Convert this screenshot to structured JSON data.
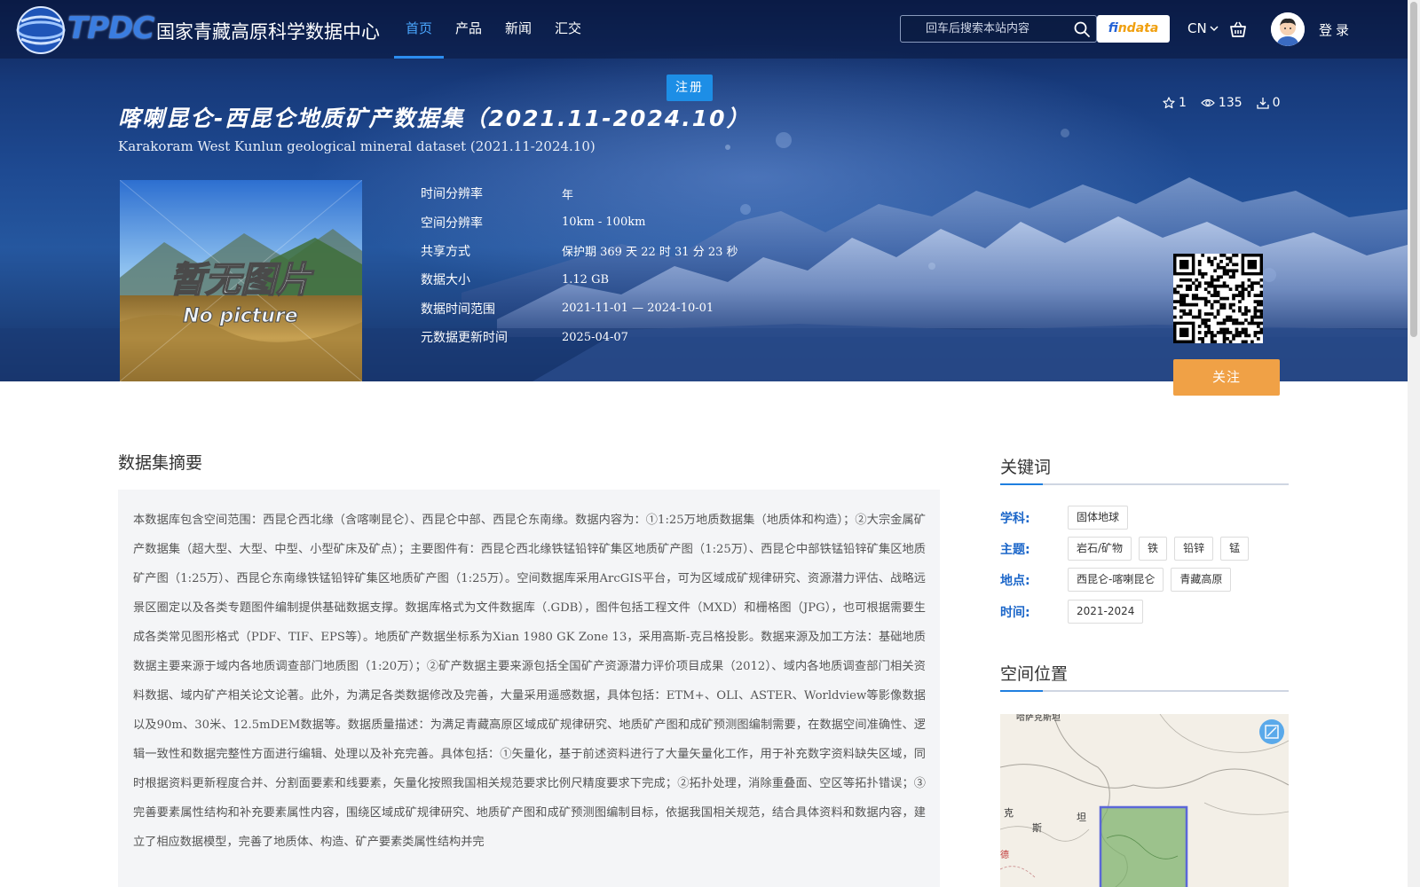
{
  "nav": {
    "logo_abbr": "TPDC",
    "logo_name": "国家青藏高原科学数据中心",
    "menu": [
      {
        "label": "首页",
        "active": true
      },
      {
        "label": "产品",
        "active": false
      },
      {
        "label": "新闻",
        "active": false
      },
      {
        "label": "汇交",
        "active": false
      }
    ],
    "search_placeholder": "回车后搜索本站内容",
    "findata": {
      "f": "f",
      "i": "i",
      "rest": "ndata"
    },
    "lang": "CN",
    "login": "登录",
    "register": "注册"
  },
  "dataset": {
    "title_cn": "喀喇昆仑-西昆仑地质矿产数据集（2021.11-2024.10）",
    "title_en": "Karakoram West Kunlun geological mineral dataset (2021.11-2024.10)",
    "stats": {
      "stars": "1",
      "views": "135",
      "downloads": "0"
    },
    "thumbnail": {
      "cn": "暂无图片",
      "en": "No picture"
    },
    "info": [
      {
        "label": "时间分辨率",
        "value": "年"
      },
      {
        "label": "空间分辨率",
        "value": "10km - 100km"
      },
      {
        "label": "共享方式",
        "value": "保护期 369 天 22 时 31 分 23 秒"
      },
      {
        "label": "数据大小",
        "value": "1.12 GB"
      },
      {
        "label": "数据时间范围",
        "value": "2021-11-01 — 2024-10-01"
      },
      {
        "label": "元数据更新时间",
        "value": "2025-04-07"
      }
    ],
    "follow": "关注"
  },
  "abstract": {
    "title": "数据集摘要",
    "text": "本数据库包含空间范围：西昆仑西北缘（含喀喇昆仑）、西昆仑中部、西昆仑东南缘。数据内容为：①1:25万地质数据集（地质体和构造）；②大宗金属矿产数据集（超大型、大型、中型、小型矿床及矿点）；主要图件有：西昆仑西北缘铁锰铅锌矿集区地质矿产图（1:25万）、西昆仑中部铁锰铅锌矿集区地质矿产图（1:25万）、西昆仑东南缘铁锰铅锌矿集区地质矿产图（1:25万）。空间数据库采用ArcGIS平台，可为区域成矿规律研究、资源潜力评估、战略远景区圈定以及各类专题图件编制提供基础数据支撑。数据库格式为文件数据库（.GDB），图件包括工程文件（MXD）和栅格图（JPG），也可根据需要生成各类常见图形格式（PDF、TIF、EPS等）。地质矿产数据坐标系为Xian 1980 GK Zone 13，采用高斯-克吕格投影。数据来源及加工方法：基础地质数据主要来源于域内各地质调查部门地质图（1:20万）；②矿产数据主要来源包括全国矿产资源潜力评价项目成果（2012）、域内各地质调查部门相关资料数据、域内矿产相关论文论著。此外，为满足各类数据修改及完善，大量采用遥感数据，具体包括：ETM+、OLI、ASTER、Worldview等影像数据以及90m、30米、12.5mDEM数据等。数据质量描述：为满足青藏高原区域成矿规律研究、地质矿产图和成矿预测图编制需要，在数据空间准确性、逻辑一致性和数据完整性方面进行编辑、处理以及补充完善。具体包括：①矢量化，基于前述资料进行了大量矢量化工作，用于补充数字资料缺失区域，同时根据资料更新程度合并、分割面要素和线要素，矢量化按照我国相关规范要求比例尺精度要求下完成；②拓扑处理，消除重叠面、空区等拓扑错误；③完善要素属性结构和补充要素属性内容，围绕区域成矿规律研究、地质矿产图和成矿预测图编制目标，依据我国相关规范，结合具体资料和数据内容，建立了相应数据模型，完善了地质体、构造、矿产要素类属性结构并完"
  },
  "keywords": {
    "title": "关键词",
    "rows": [
      {
        "label": "学科:",
        "tags": [
          "固体地球"
        ]
      },
      {
        "label": "主题:",
        "tags": [
          "岩石/矿物",
          "铁",
          "铅锌",
          "锰"
        ]
      },
      {
        "label": "地点:",
        "tags": [
          "西昆仑-喀喇昆仑",
          "青藏高原"
        ]
      },
      {
        "label": "时间:",
        "tags": [
          "2021-2024"
        ]
      }
    ]
  },
  "location": {
    "title": "空间位置",
    "labels": {
      "top": "哈萨克斯坦",
      "ke": "克",
      "si": "斯",
      "tan": "坦",
      "de": "德"
    }
  },
  "colors": {
    "accent": "#2c8df0",
    "follow": "#f0a146",
    "register": "#1d8ee6",
    "keyword_label": "#1b66c9"
  }
}
